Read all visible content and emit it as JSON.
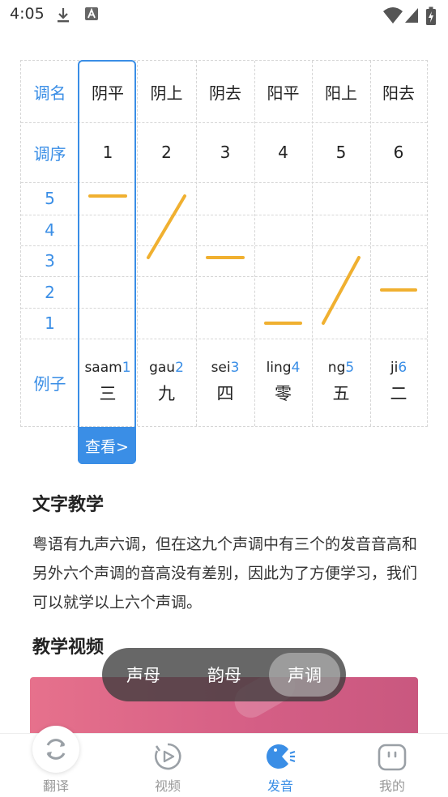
{
  "status_bar": {
    "time": "4:05"
  },
  "tone_table": {
    "labels": {
      "name": "调名",
      "order": "调序",
      "example": "例子"
    },
    "levels": [
      "5",
      "4",
      "3",
      "2",
      "1"
    ],
    "columns": [
      {
        "name": "阴平",
        "order": "1",
        "pinyin": "saam",
        "tone": "1",
        "char": "三"
      },
      {
        "name": "阴上",
        "order": "2",
        "pinyin": "gau",
        "tone": "2",
        "char": "九"
      },
      {
        "name": "阴去",
        "order": "3",
        "pinyin": "sei",
        "tone": "3",
        "char": "四"
      },
      {
        "name": "阳平",
        "order": "4",
        "pinyin": "ling",
        "tone": "4",
        "char": "零"
      },
      {
        "name": "阳上",
        "order": "5",
        "pinyin": "ng",
        "tone": "5",
        "char": "五"
      },
      {
        "name": "阳去",
        "order": "6",
        "pinyin": "ji",
        "tone": "6",
        "char": "二"
      }
    ],
    "contours": [
      [
        5,
        5
      ],
      [
        3,
        5
      ],
      [
        3,
        3
      ],
      [
        1,
        1
      ],
      [
        1,
        3
      ],
      [
        2,
        2
      ]
    ],
    "view_button": "查看>",
    "line_color": "#f0b030",
    "accent_color": "#3a8ee6"
  },
  "text_section": {
    "title": "文字教学",
    "paragraph": "粤语有九声六调，但在这九个声调中有三个的发音音高和另外六个声调的音高没有差别，因此为了方便学习，我们可以就学以上六个声调。"
  },
  "video_section": {
    "title": "教学视频"
  },
  "segment": {
    "options": [
      "声母",
      "韵母",
      "声调"
    ],
    "active": "声调"
  },
  "tabbar": {
    "tabs": [
      {
        "label": "翻译",
        "icon": "refresh-icon"
      },
      {
        "label": "视频",
        "icon": "play-icon"
      },
      {
        "label": "发音",
        "icon": "pronounce-icon"
      },
      {
        "label": "我的",
        "icon": "profile-icon"
      }
    ],
    "active": "发音"
  }
}
